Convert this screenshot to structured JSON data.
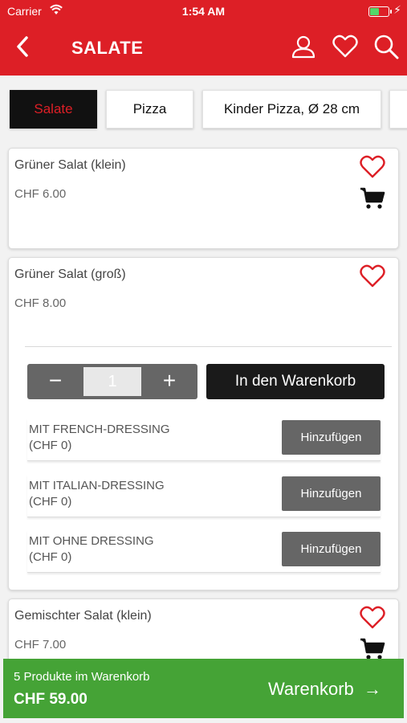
{
  "status_bar": {
    "carrier": "Carrier",
    "time": "1:54 AM"
  },
  "header": {
    "title": "SALATE",
    "icons": [
      "back-chevron-icon",
      "user-icon",
      "heart-icon",
      "search-icon"
    ]
  },
  "categories": [
    {
      "label": "Salate",
      "active": true
    },
    {
      "label": "Pizza",
      "active": false
    },
    {
      "label": "Kinder Pizza, Ø 28 cm",
      "active": false
    }
  ],
  "products": [
    {
      "name": "Grüner Salat (klein)",
      "price": "CHF 6.00"
    },
    {
      "name": "Grüner Salat (groß)",
      "price": "CHF 8.00",
      "expanded": {
        "quantity": "1",
        "minus": "−",
        "plus": "+",
        "add_to_cart": "In den Warenkorb",
        "options": [
          {
            "line1": "MIT FRENCH-DRESSING",
            "line2": "(CHF 0)",
            "button": "Hinzufügen"
          },
          {
            "line1": "MIT ITALIAN-DRESSING",
            "line2": "(CHF 0)",
            "button": "Hinzufügen"
          },
          {
            "line1": "MIT OHNE DRESSING",
            "line2": "(CHF 0)",
            "button": "Hinzufügen"
          }
        ]
      }
    },
    {
      "name": "Gemischter Salat (klein)",
      "price": "CHF 7.00"
    }
  ],
  "basket": {
    "count_text": "5 Produkte im Warenkorb",
    "total": "CHF 59.00",
    "button": "Warenkorb",
    "arrow": "→"
  },
  "colors": {
    "brand_red": "#dd1f26",
    "basket_green": "#45a336",
    "dark": "#1a1a1a",
    "gray_button": "#666666"
  }
}
